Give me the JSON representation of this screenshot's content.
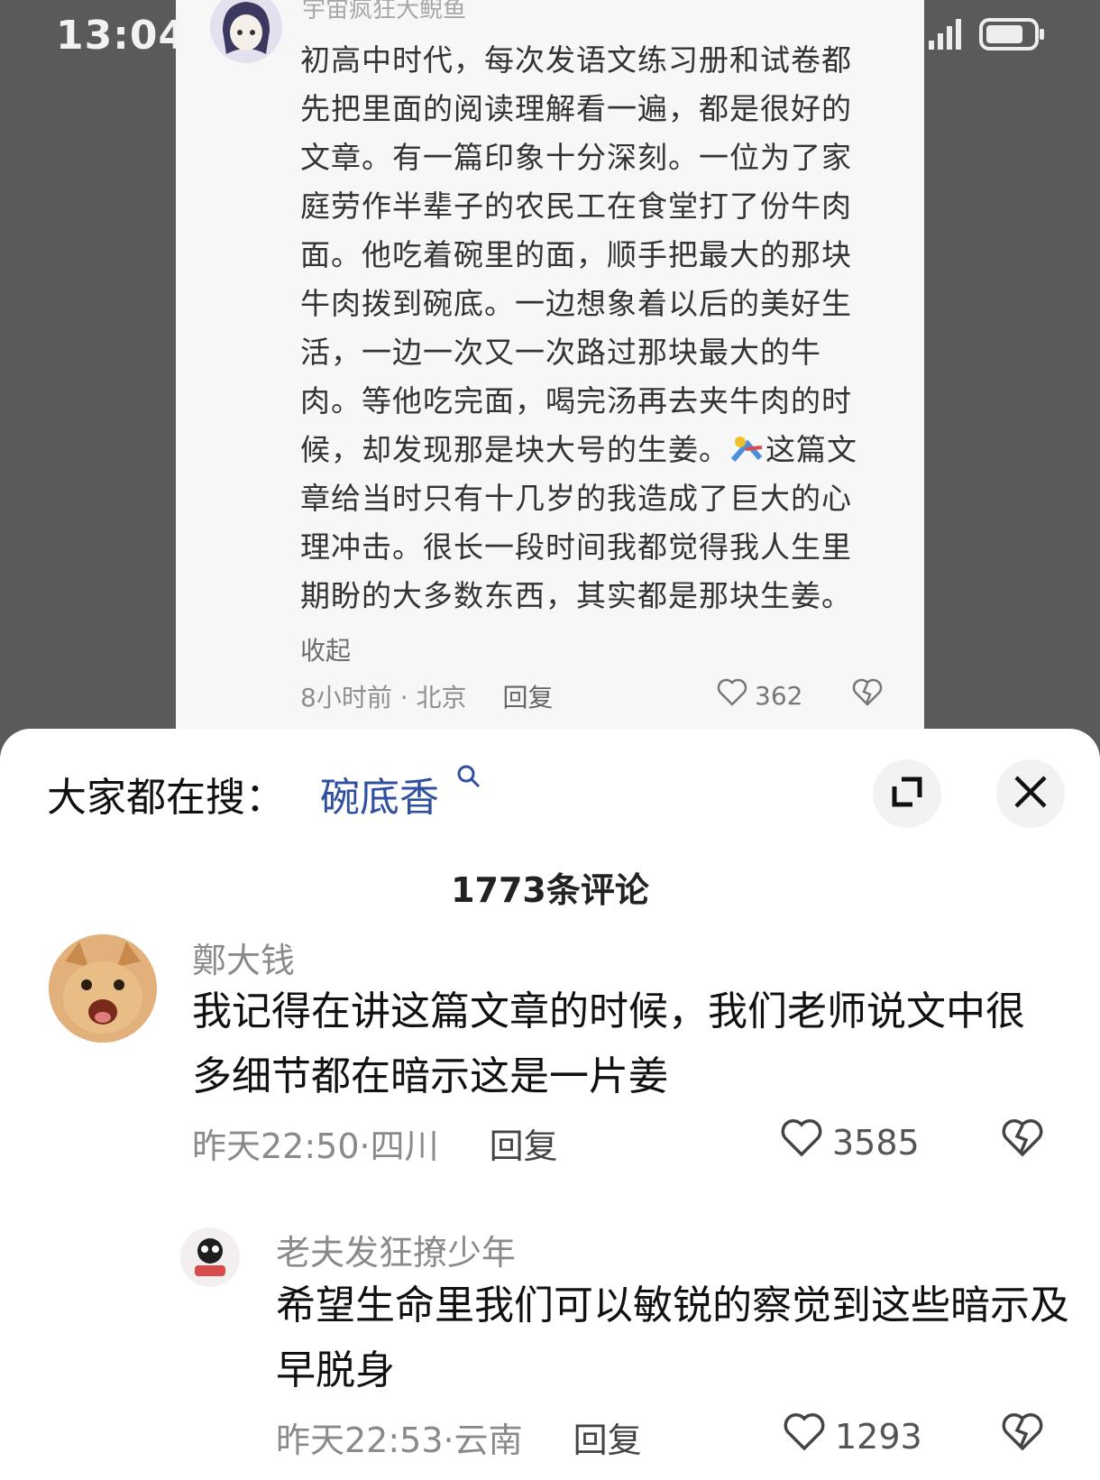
{
  "status_bar": {
    "time": "13:04"
  },
  "background_post": {
    "username": "宇宙疯狂大鲵鱼",
    "text_lines": [
      "初高中时代，每次发语文练习册和试卷都",
      "先把里面的阅读理解看一遍，都是很好的",
      "文章。有一篇印象十分深刻。一位为了家",
      "庭劳作半辈子的农民工在食堂打了份牛肉",
      "面。他吃着碗里的面，顺手把最大的那块",
      "牛肉拨到碗底。一边想象着以后的美好生",
      "活，一边一次又一次路过那块最大的牛",
      "肉。等他吃完面，喝完汤再去夹牛肉的时",
      "候，却发现那是块大号的生姜。",
      "这篇文",
      "章给当时只有十几岁的我造成了巨大的心",
      "理冲击。很长一段时间我都觉得我人生里",
      "期盼的大多数东西，其实都是那块生姜。"
    ],
    "collapse_label": "收起",
    "time_location": "8小时前 · 北京",
    "reply_label": "回复",
    "like_count": "362"
  },
  "sheet": {
    "search_prefix": "大家都在搜：",
    "search_term": "碗底香",
    "comment_count": "1773条评论",
    "comments": [
      {
        "username": "鄭大钱",
        "text": "我记得在讲这篇文章的时候，我们老师说文中很多细节都在暗示这是一片姜",
        "time_location": "昨天22:50·四川",
        "reply_label": "回复",
        "like_count": "3585"
      },
      {
        "username": "老夫发狂撩少年",
        "text": "希望生命里我们可以敏锐的察觉到这些暗示及早脱身",
        "time_location": "昨天22:53·云南",
        "reply_label": "回复",
        "like_count": "1293"
      }
    ]
  },
  "colors": {
    "link_blue": "#2f4fa0",
    "sheet_bg": "#ffffff",
    "dim_bg": "#5a5a5a"
  },
  "icons": [
    "signal-icon",
    "wifi-icon",
    "battery-icon",
    "search-icon",
    "expand-icon",
    "close-icon",
    "heart-icon",
    "broken-heart-icon"
  ]
}
